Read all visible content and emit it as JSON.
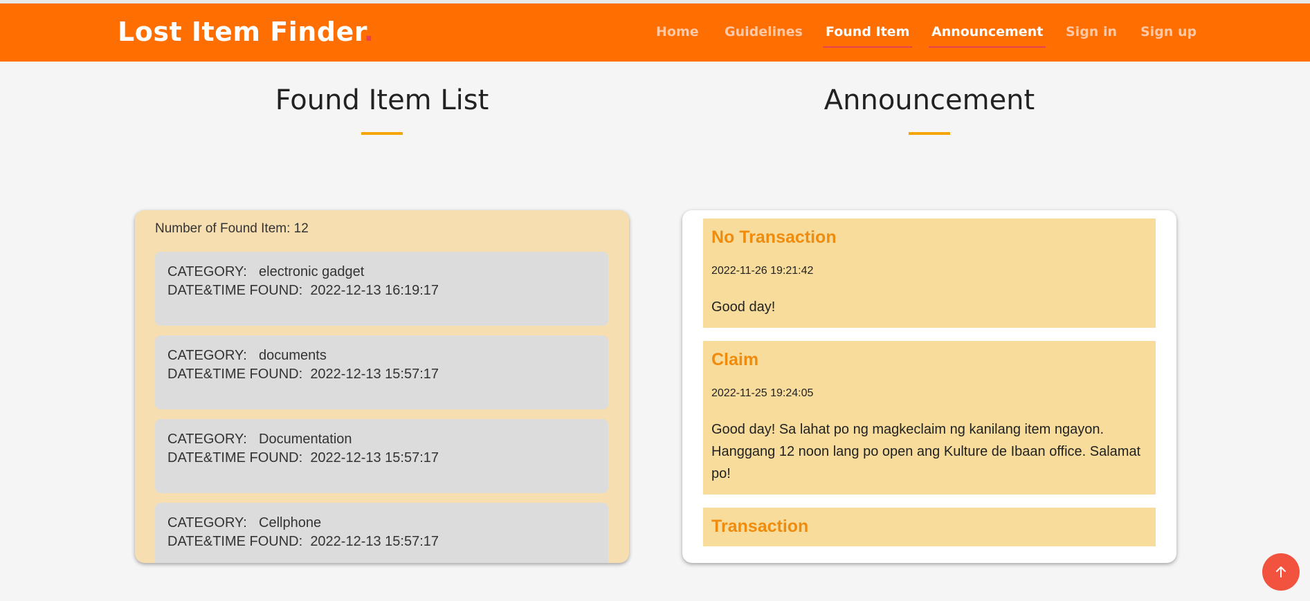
{
  "header": {
    "logo_text": "Lost Item Finder",
    "logo_dot": ".",
    "nav": [
      {
        "label": "Home"
      },
      {
        "label": "Guidelines"
      },
      {
        "label": "Found Item"
      },
      {
        "label": "Announcement"
      },
      {
        "label": "Sign in"
      },
      {
        "label": "Sign up"
      }
    ]
  },
  "found_section": {
    "title": "Found Item List",
    "count_label": "Number of Found Item: 12",
    "category_label": "CATEGORY:",
    "date_label": "DATE&TIME FOUND:",
    "items": [
      {
        "category": "electronic gadget",
        "date": "2022-12-13 16:19:17"
      },
      {
        "category": "documents",
        "date": "2022-12-13 15:57:17"
      },
      {
        "category": "Documentation",
        "date": "2022-12-13 15:57:17"
      },
      {
        "category": "Cellphone",
        "date": "2022-12-13 15:57:17"
      }
    ]
  },
  "announcement_section": {
    "title": "Announcement",
    "posts": [
      {
        "title": "No Transaction",
        "date": "2022-11-26 19:21:42",
        "body": "Good day!"
      },
      {
        "title": "Claim",
        "date": "2022-11-25 19:24:05",
        "body": "Good day! Sa lahat po ng magkeclaim ng kanilang item ngayon. Hanggang 12 noon lang po open ang Kulture de Ibaan office. Salamat po!"
      },
      {
        "title": "Transaction",
        "date": "",
        "body": ""
      }
    ]
  },
  "scroll_top": {
    "icon": "arrow-up-icon"
  },
  "colors": {
    "navbar": "#ff6e00",
    "accent": "#f5a400",
    "found_panel": "#f6deb0",
    "announcement_card": "#f7dc9c",
    "scroll_button": "#f2533f"
  }
}
